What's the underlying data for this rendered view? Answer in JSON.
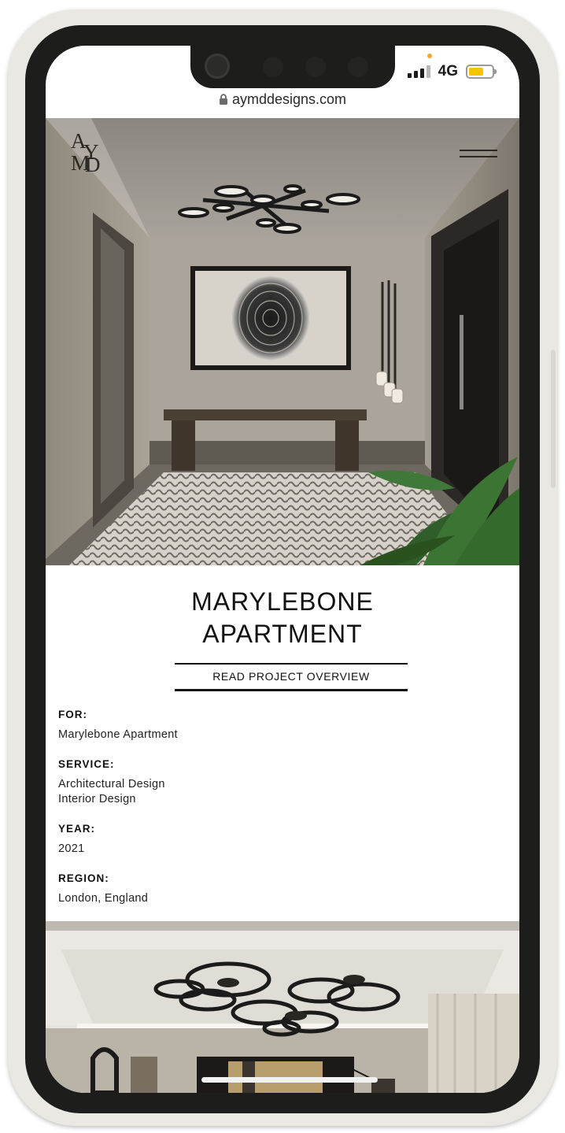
{
  "status_bar": {
    "network": "4G",
    "signal_bars_active": 3,
    "signal_bars_total": 4,
    "battery_level": 0.65,
    "battery_color": "#f4c400"
  },
  "browser": {
    "url": "aymddesigns.com",
    "lock_icon": "lock-icon"
  },
  "header": {
    "logo_letters": [
      "A",
      "Y",
      "M",
      "D"
    ],
    "menu_icon": "hamburger-menu-icon"
  },
  "project": {
    "title_line1": "MARYLEBONE",
    "title_line2": "APARTMENT",
    "overview_link": "READ PROJECT OVERVIEW"
  },
  "details": [
    {
      "label": "FOR:",
      "values": [
        "Marylebone Apartment"
      ]
    },
    {
      "label": "SERVICE:",
      "values": [
        "Architectural Design",
        "Interior Design"
      ]
    },
    {
      "label": "YEAR:",
      "values": [
        "2021"
      ]
    },
    {
      "label": "REGION:",
      "values": [
        "London, England"
      ]
    }
  ]
}
